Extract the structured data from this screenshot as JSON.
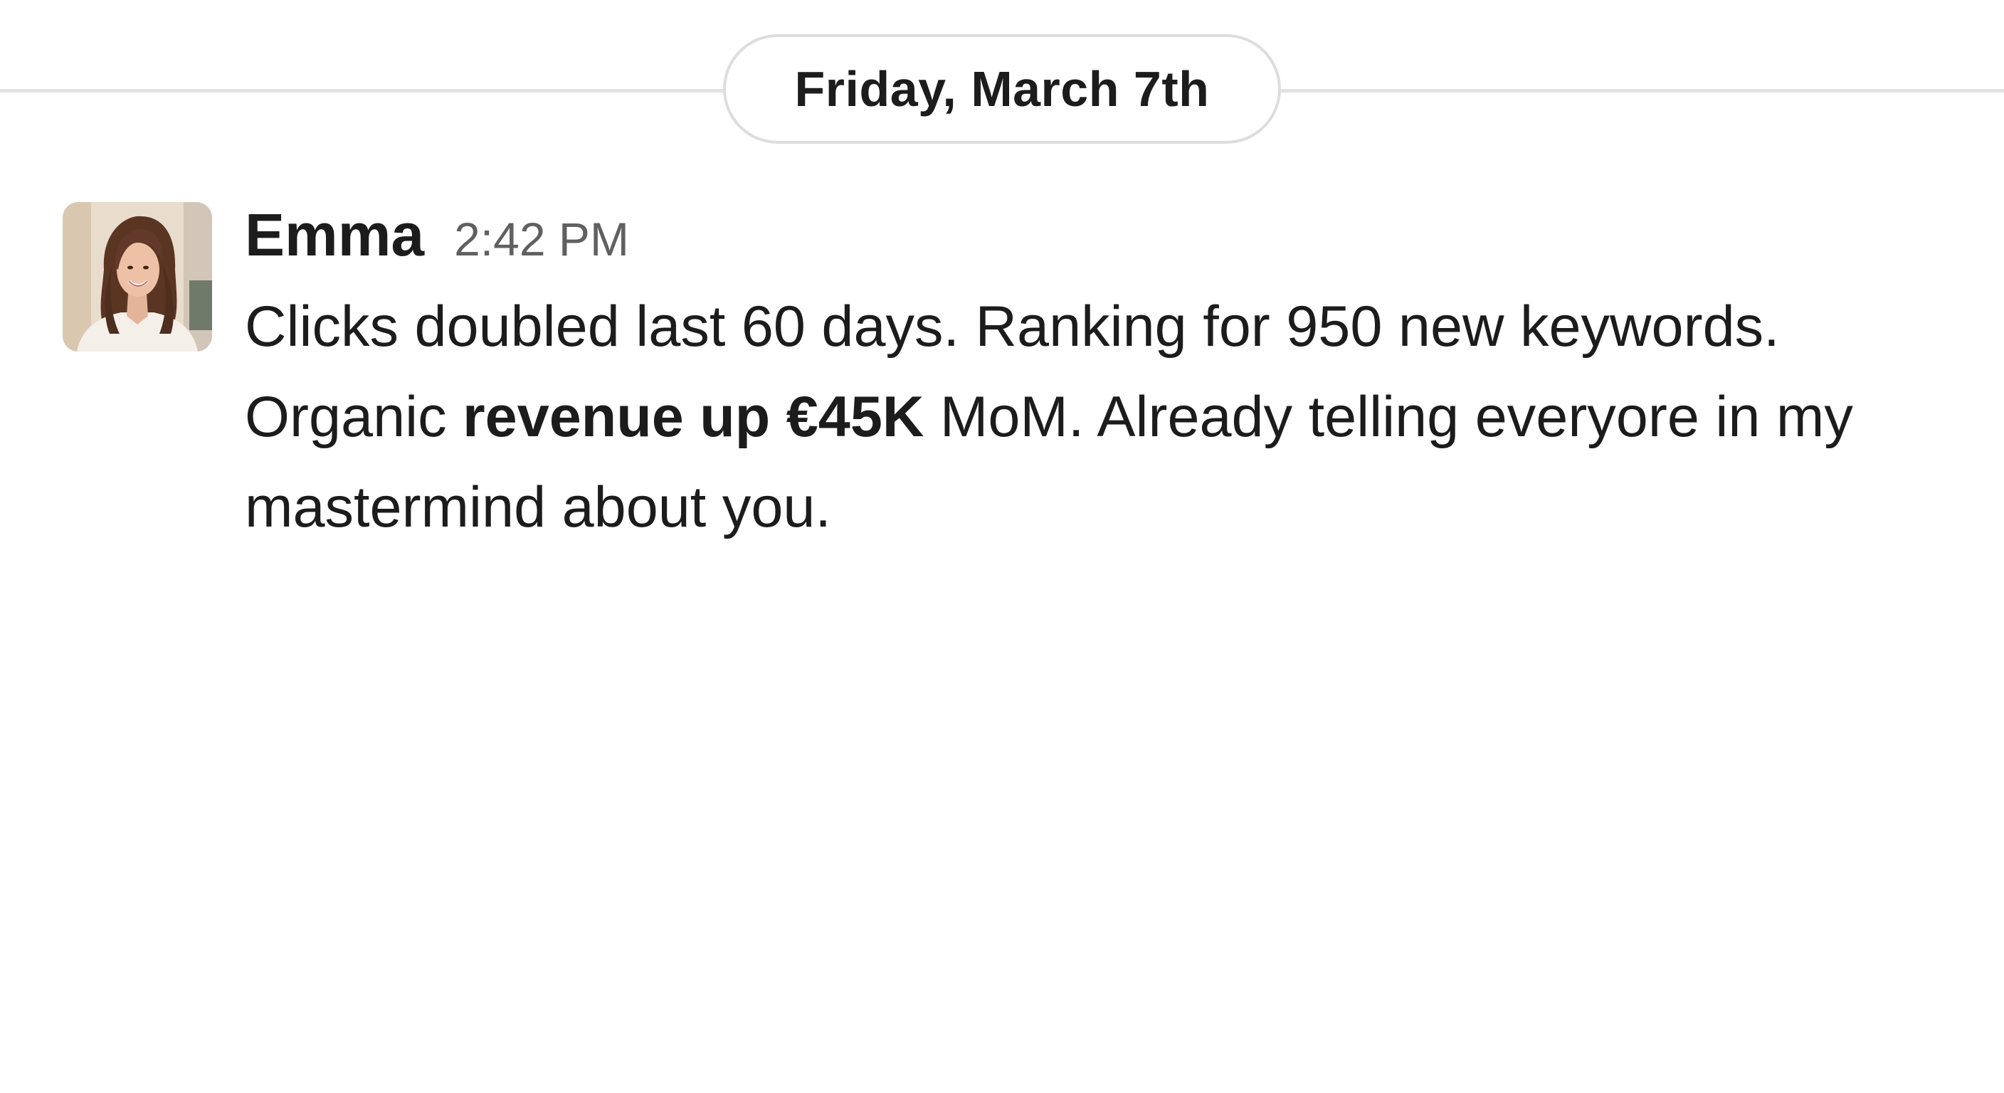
{
  "date_divider": {
    "label": "Friday, March 7th"
  },
  "message": {
    "author": "Emma",
    "timestamp": "2:42 PM",
    "avatar_icon": "user-avatar-photo",
    "text_part1": "Clicks doubled last 60 days. Ranking for 950 new keywords. Organic ",
    "text_bold": "revenue up €45K",
    "text_part2": " MoM. Already telling everyore in my mastermind about you."
  }
}
